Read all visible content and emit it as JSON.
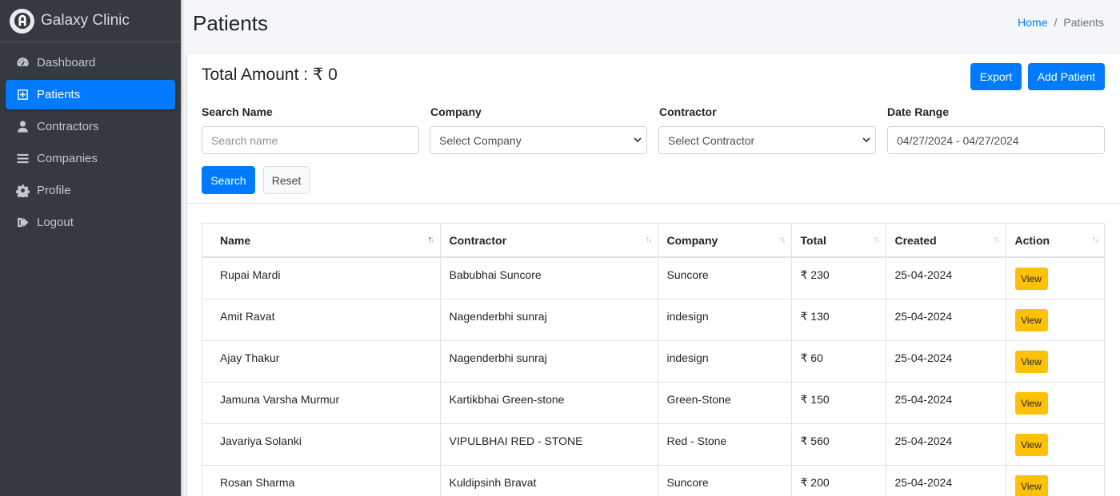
{
  "app": {
    "name": "Galaxy Clinic"
  },
  "sidebar": {
    "items": [
      {
        "label": "Dashboard",
        "icon": "tachometer-icon",
        "active": false
      },
      {
        "label": "Patients",
        "icon": "plus-square-icon",
        "active": true
      },
      {
        "label": "Contractors",
        "icon": "user-icon",
        "active": false
      },
      {
        "label": "Companies",
        "icon": "bars-icon",
        "active": false
      },
      {
        "label": "Profile",
        "icon": "gear-icon",
        "active": false
      },
      {
        "label": "Logout",
        "icon": "sign-out-icon",
        "active": false
      }
    ]
  },
  "header": {
    "title": "Patients",
    "breadcrumb": {
      "home": "Home",
      "separator": "/",
      "current": "Patients"
    }
  },
  "card": {
    "total_amount": "Total Amount : ₹ 0",
    "export_label": "Export",
    "add_label": "Add Patient"
  },
  "filters": {
    "search_name": {
      "label": "Search Name",
      "placeholder": "Search name",
      "value": ""
    },
    "company": {
      "label": "Company",
      "value": "Select Company"
    },
    "contractor": {
      "label": "Contractor",
      "value": "Select Contractor"
    },
    "date_range": {
      "label": "Date Range",
      "value": "04/27/2024 - 04/27/2024"
    },
    "search_label": "Search",
    "reset_label": "Reset"
  },
  "table": {
    "columns": [
      "Name",
      "Contractor",
      "Company",
      "Total",
      "Created",
      "Action"
    ],
    "rows": [
      {
        "name": "Rupai Mardi",
        "contractor": "Babubhai Suncore",
        "company": "Suncore",
        "total": "₹ 230",
        "created": "25-04-2024",
        "action": "View"
      },
      {
        "name": "Amit Ravat",
        "contractor": "Nagenderbhi sunraj",
        "company": "indesign",
        "total": "₹ 130",
        "created": "25-04-2024",
        "action": "View"
      },
      {
        "name": "Ajay Thakur",
        "contractor": "Nagenderbhi sunraj",
        "company": "indesign",
        "total": "₹ 60",
        "created": "25-04-2024",
        "action": "View"
      },
      {
        "name": "Jamuna Varsha Murmur",
        "contractor": "Kartikbhai Green-stone",
        "company": "Green-Stone",
        "total": "₹ 150",
        "created": "25-04-2024",
        "action": "View"
      },
      {
        "name": "Javariya Solanki",
        "contractor": "VIPULBHAI RED - STONE",
        "company": "Red - Stone",
        "total": "₹ 560",
        "created": "25-04-2024",
        "action": "View"
      },
      {
        "name": "Rosan Sharma",
        "contractor": "Kuldipsinh Bravat",
        "company": "Suncore",
        "total": "₹ 200",
        "created": "25-04-2024",
        "action": "View"
      }
    ]
  },
  "colors": {
    "primary": "#007bff",
    "warning": "#ffc107",
    "sidebar_bg": "#343a40"
  }
}
